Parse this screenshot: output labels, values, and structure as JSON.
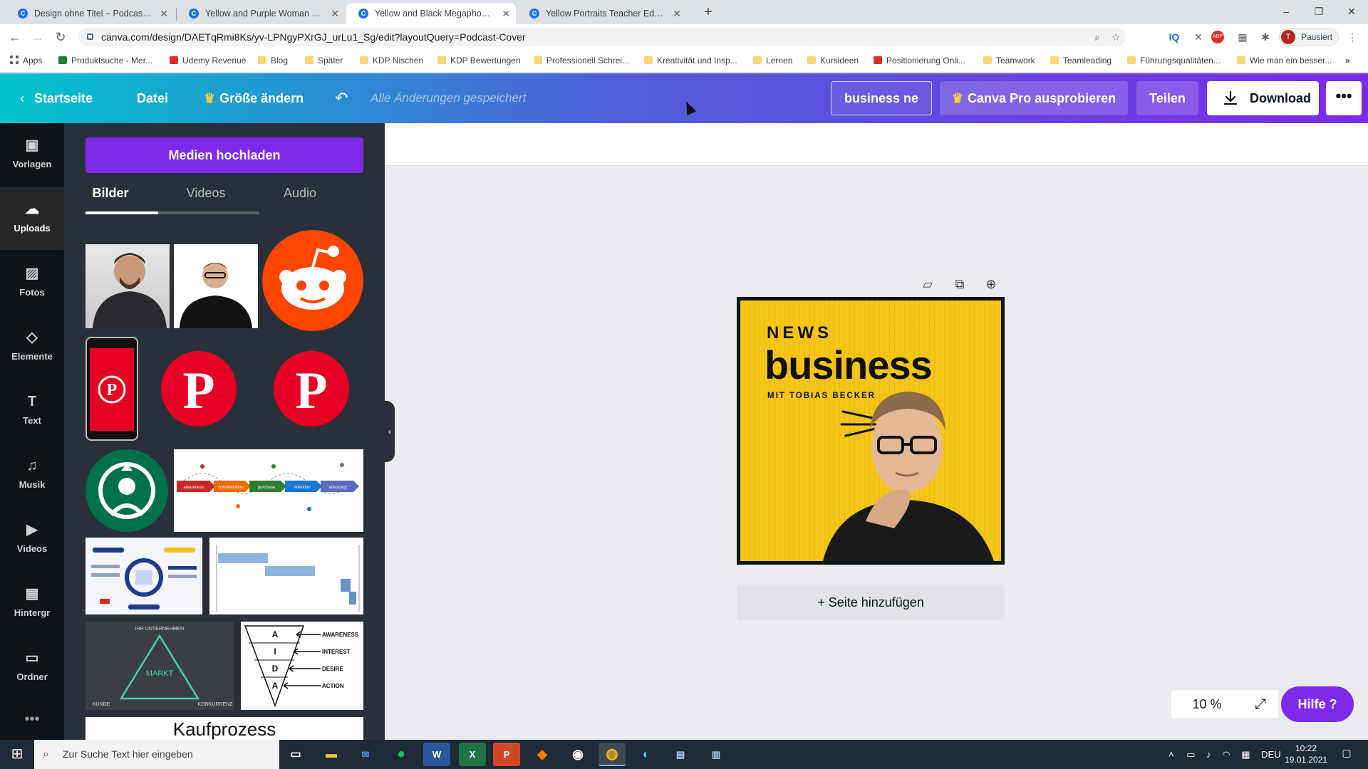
{
  "browser": {
    "tabs": [
      {
        "title": "Design ohne Titel – Podcast Cover",
        "active": false
      },
      {
        "title": "Yellow and Purple Woman Portrait",
        "active": false
      },
      {
        "title": "Yellow and Black Megaphone Po",
        "active": true
      },
      {
        "title": "Yellow Portraits Teacher Education",
        "active": false
      }
    ],
    "new_tab": "+",
    "window_controls": {
      "minimize": "–",
      "restore": "❐",
      "close": "✕"
    },
    "url": "canva.com/design/DAETqRmi8Ks/yv-LPNgyPXrGJ_urLu1_Sg/edit?layoutQuery=Podcast-Cover",
    "profile": {
      "initial": "T",
      "label": "Pausiert"
    },
    "extensions": [
      "IQ",
      "ABP"
    ],
    "bookmarks": [
      {
        "label": "Apps",
        "icon": "grid"
      },
      {
        "label": "Produktsuche - Mer...",
        "icon": "green"
      },
      {
        "label": "Udemy Revenue",
        "icon": "red"
      },
      {
        "label": "Blog",
        "icon": "folder"
      },
      {
        "label": "Später",
        "icon": "folder"
      },
      {
        "label": "KDP Nischen",
        "icon": "folder"
      },
      {
        "label": "KDP Bewertungen",
        "icon": "folder"
      },
      {
        "label": "Professionell Schrei...",
        "icon": "folder"
      },
      {
        "label": "Kreativität und Insp...",
        "icon": "folder"
      },
      {
        "label": "Lernen",
        "icon": "folder"
      },
      {
        "label": "Kursideen",
        "icon": "folder"
      },
      {
        "label": "Positionierung Onli...",
        "icon": "red"
      },
      {
        "label": "Teamwork",
        "icon": "folder"
      },
      {
        "label": "Teamleading",
        "icon": "folder"
      },
      {
        "label": "Führungsqualitäten...",
        "icon": "folder"
      },
      {
        "label": "Wie man ein besser...",
        "icon": "folder"
      }
    ]
  },
  "header": {
    "home": "Startseite",
    "file": "Datei",
    "resize": "Größe ändern",
    "saved_status": "Alle Änderungen gespeichert",
    "title_value": "business ne",
    "try_pro": "Canva Pro ausprobieren",
    "share": "Teilen",
    "download": "Download",
    "more": "•••"
  },
  "rail": {
    "items": [
      {
        "label": "Vorlagen",
        "icon": "template-icon",
        "glyph": "▣"
      },
      {
        "label": "Uploads",
        "icon": "upload-cloud-icon",
        "glyph": "☁",
        "active": true
      },
      {
        "label": "Fotos",
        "icon": "photo-icon",
        "glyph": "▨"
      },
      {
        "label": "Elemente",
        "icon": "shapes-icon",
        "glyph": "◇"
      },
      {
        "label": "Text",
        "icon": "text-icon",
        "glyph": "T"
      },
      {
        "label": "Musik",
        "icon": "music-icon",
        "glyph": "♫"
      },
      {
        "label": "Videos",
        "icon": "video-icon",
        "glyph": "▶"
      },
      {
        "label": "Hintergr",
        "icon": "background-icon",
        "glyph": "▦"
      },
      {
        "label": "Ordner",
        "icon": "folder-icon",
        "glyph": "▭"
      }
    ],
    "more": "•••"
  },
  "panel": {
    "upload_button": "Medien hochladen",
    "tabs": [
      "Bilder",
      "Videos",
      "Audio"
    ],
    "active_tab": "Bilder",
    "kaufprozess_label": "Kaufprozess",
    "aida_letters": [
      "A",
      "I",
      "D",
      "A"
    ],
    "aida_words": [
      "AWARENESS",
      "INTEREST",
      "DESIRE",
      "ACTION"
    ],
    "markt_label": "MARKT",
    "markt_top": "IHR UNTERNEHMEN",
    "markt_left": "KUNDE",
    "markt_right": "KONKURRENZ",
    "journey_steps": [
      "awareness",
      "consideration",
      "purchase",
      "retention",
      "advocacy"
    ]
  },
  "design": {
    "kicker": "NEWS",
    "title": "business",
    "subtitle": "MIT TOBIAS BECKER",
    "background_color": "#f5c518",
    "add_page": "+ Seite hinzufügen"
  },
  "canvas_controls": {
    "zoom": "10 %",
    "help": "Hilfe ?"
  },
  "taskbar": {
    "search_placeholder": "Zur Suche Text hier eingeben",
    "language": "DEU",
    "time": "10:22",
    "date": "19.01.2021"
  }
}
